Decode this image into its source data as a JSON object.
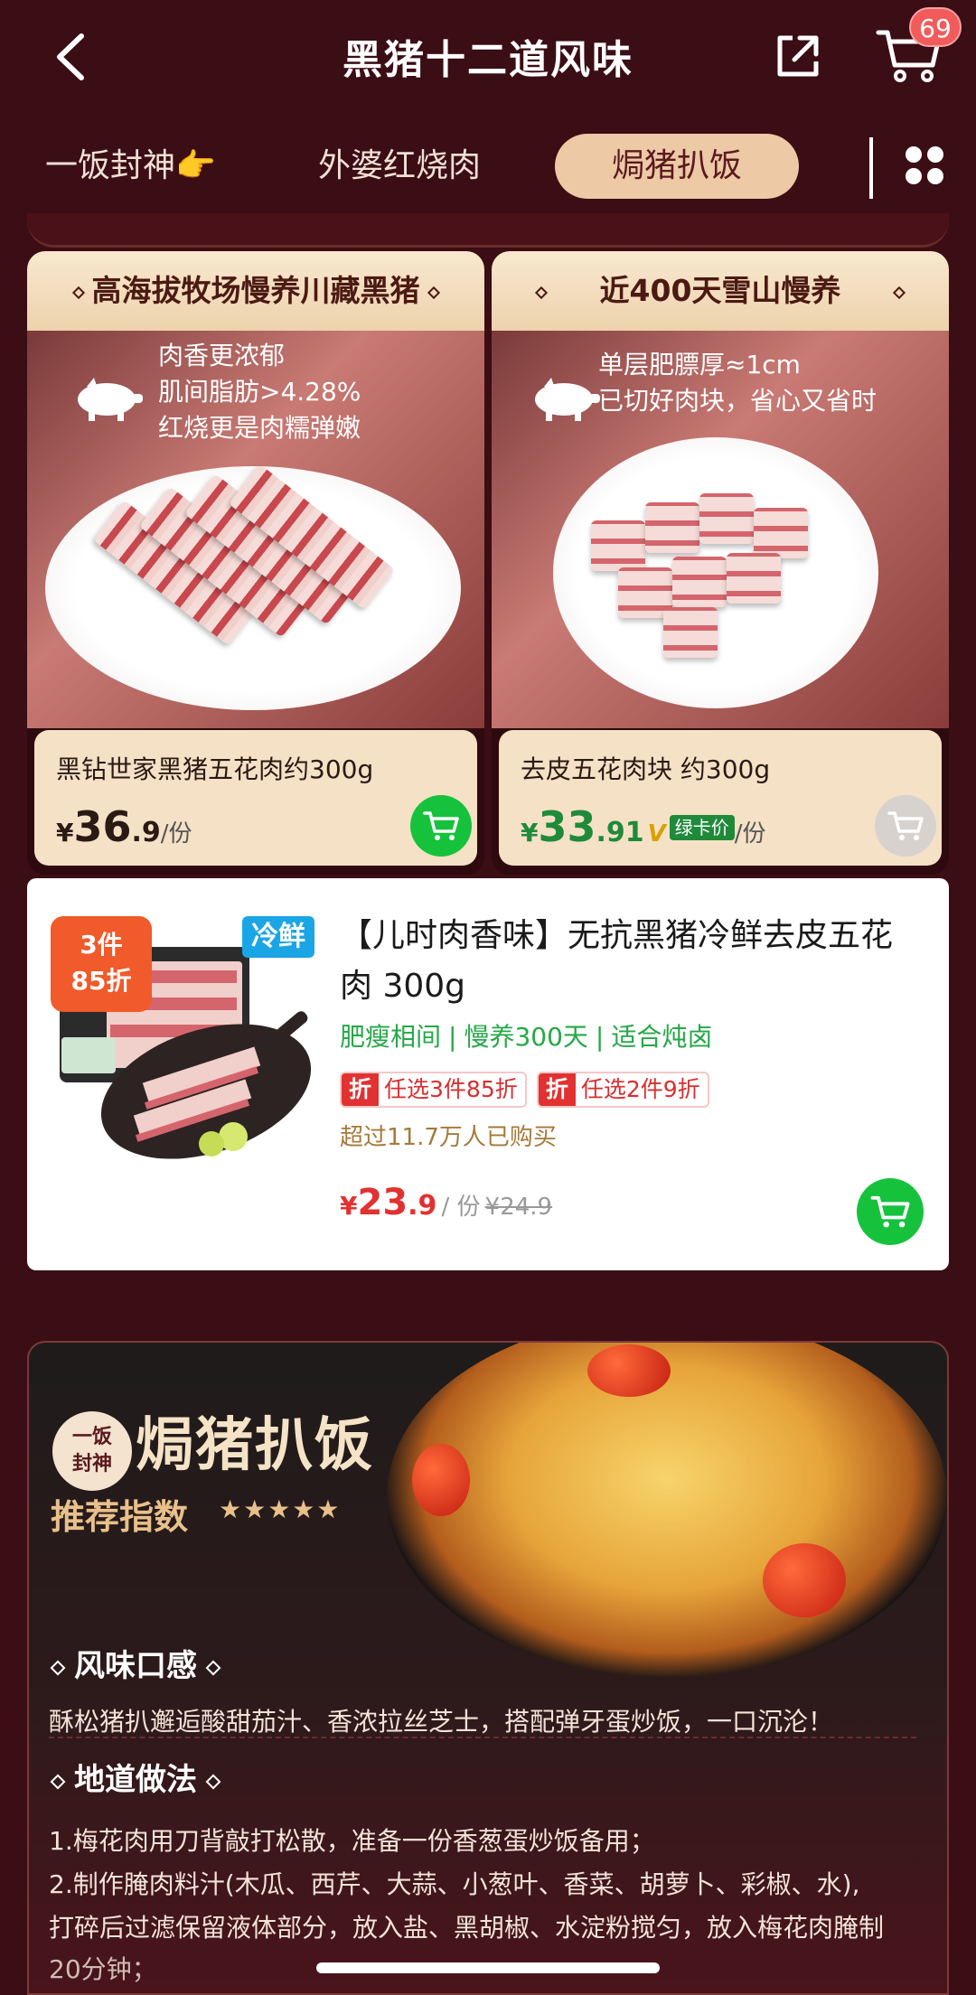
{
  "header": {
    "title": "黑猪十二道风味",
    "cart_count": "69"
  },
  "tabs": [
    {
      "label": "一饭封神👉"
    },
    {
      "label": "外婆红烧肉"
    },
    {
      "label": "焗猪扒饭"
    }
  ],
  "products": [
    {
      "headline": "高海拔牧场慢养川藏黑猪",
      "features": [
        "肉香更浓郁",
        "肌间脂肪>4.28%",
        "红烧更是肉糯弹嫩"
      ],
      "name": "黑钻世家黑猪五花肉约300g",
      "currency": "¥",
      "price_int": "36",
      "price_dec": ".9",
      "unit": "/份"
    },
    {
      "headline": "近400天雪山慢养",
      "features": [
        "单层肥膘厚≈1cm",
        "已切好肉块，省心又省时"
      ],
      "name": "去皮五花肉块 约300g",
      "currency": "¥",
      "price_int": "33",
      "price_dec": ".91",
      "vmark": "V",
      "card_tag": "绿卡价",
      "unit": "/份"
    }
  ],
  "list_product": {
    "promo_line1": "3件",
    "promo_line2": "85折",
    "fresh_tag": "冷鲜",
    "title": "【儿时肉香味】无抗黑猪冷鲜去皮五花肉 300g",
    "features": [
      "肥瘦相间",
      "慢养300天",
      "适合炖卤"
    ],
    "feature_sep": "|",
    "coupons": [
      {
        "tag": "折",
        "text": "任选3件85折"
      },
      {
        "tag": "折",
        "text": "任选2件9折"
      }
    ],
    "bought": "超过11.7万人已购买",
    "currency": "¥",
    "price_int": "23",
    "price_dec": ".9",
    "unit": "/ 份",
    "old_price": "¥24.9"
  },
  "banner": {
    "badge_line1": "一饭",
    "badge_line2": "封神",
    "title": "焗猪扒饭",
    "subtitle": "推荐指数",
    "stars": "★★★★★",
    "section1_title": "风味口感",
    "section1_text": "酥松猪扒邂逅酸甜茄汁、香浓拉丝芝士，搭配弹牙蛋炒饭，一口沉沦！",
    "section2_title": "地道做法",
    "steps": [
      "1.梅花肉用刀背敲打松散，准备一份香葱蛋炒饭备用；",
      "2.制作腌肉料汁(木瓜、西芹、大蒜、小葱叶、香菜、胡萝卜、彩椒、水),",
      "打碎后过滤保留液体部分，放入盐、黑胡椒、水淀粉搅匀，放入梅花肉腌制",
      "20分钟；"
    ]
  },
  "colors": {
    "background": "#3b0d14",
    "accent_tab": "#edc9a6",
    "cart_green": "#16c23c",
    "price_red": "#e23131",
    "feature_green": "#26a847"
  },
  "icons": {
    "back": "back-arrow-icon",
    "share": "share-icon",
    "cart": "cart-icon",
    "grid": "grid-icon",
    "pig": "pig-icon"
  }
}
